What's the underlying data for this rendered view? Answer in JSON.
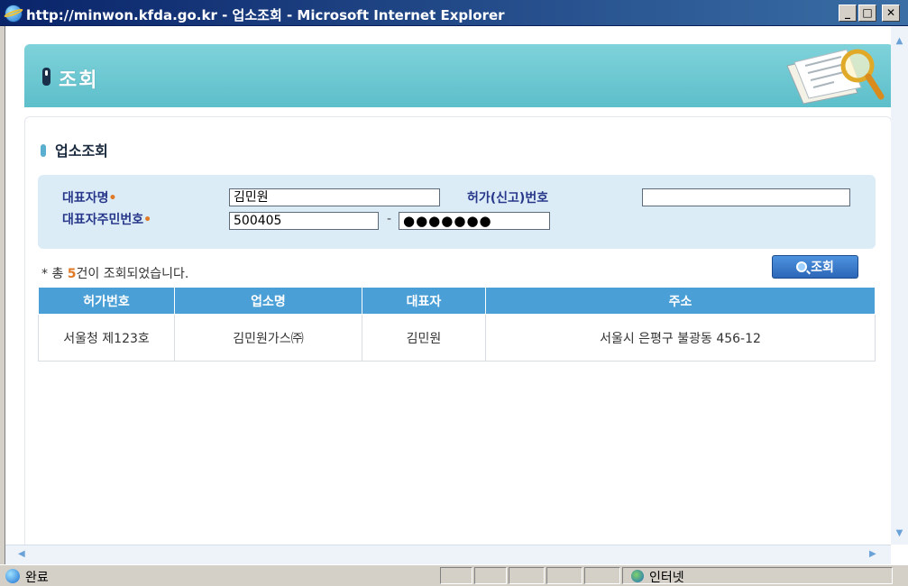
{
  "window": {
    "title": "http://minwon.kfda.go.kr - 업소조회 - Microsoft Internet Explorer",
    "min_label": "_",
    "max_label": "□",
    "close_label": "✕"
  },
  "banner": {
    "title": "조회"
  },
  "section": {
    "title": "업소조회"
  },
  "form": {
    "rep_name_label": "대표자명",
    "rep_name_value": "김민원",
    "license_label": "허가(신고)번호",
    "license_value": "",
    "rep_id_label": "대표자주민번호",
    "rep_id_front": "500405",
    "rep_id_separator": "-",
    "rep_id_back": "●●●●●●●",
    "required_mark": "•"
  },
  "result": {
    "count_prefix": "* 총 ",
    "count": "5",
    "count_suffix": "건이 조회되었습니다."
  },
  "search_button": {
    "label": "조회"
  },
  "table": {
    "headers": [
      "허가번호",
      "업소명",
      "대표자",
      "주소"
    ],
    "rows": [
      [
        "서울청 제123호",
        "김민원가스㈜",
        "김민원",
        "서울시 은평구 불광동 456-12"
      ]
    ]
  },
  "statusbar": {
    "status": "완료",
    "zone": "인터넷"
  },
  "colors": {
    "titlebar": "#0a246a",
    "banner": "#5dbfca",
    "table_header": "#4a9fd6",
    "form_bg": "#dcecf7",
    "accent_orange": "#e07a27"
  }
}
